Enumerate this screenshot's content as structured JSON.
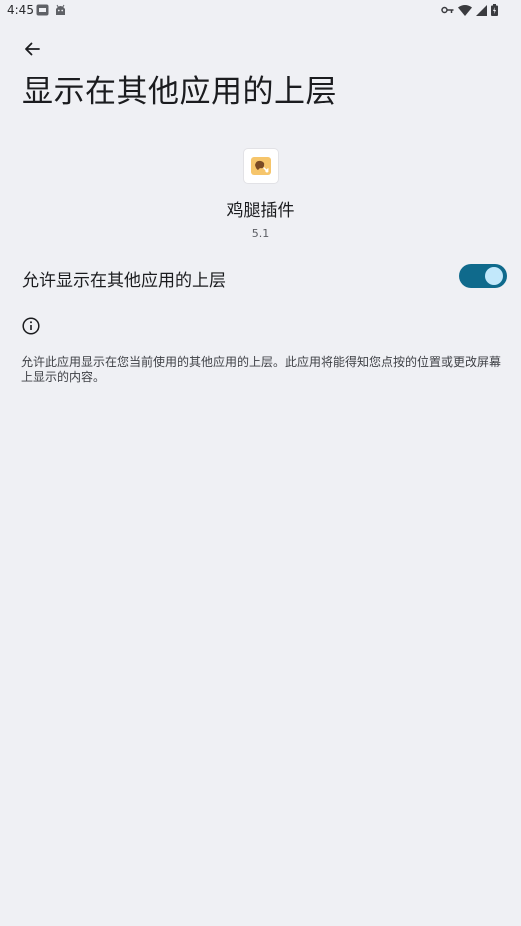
{
  "status_bar": {
    "time": "4:45",
    "left_icons": [
      "sim-card-icon",
      "android-robot-icon"
    ],
    "right_icons": [
      "vpn-key-icon",
      "wifi-icon",
      "signal-icon",
      "battery-icon"
    ]
  },
  "header": {
    "title": "显示在其他应用的上层"
  },
  "app": {
    "name": "鸡腿插件",
    "version": "5.1",
    "icon": "app-icon"
  },
  "permission": {
    "label": "允许显示在其他应用的上层",
    "enabled": true
  },
  "info": {
    "description": "允许此应用显示在您当前使用的其他应用的上层。此应用将能得知您点按的位置或更改屏幕上显示的内容。"
  },
  "colors": {
    "background": "#eff0f4",
    "accent": "#0f6a8c",
    "thumb": "#c2e8fb"
  }
}
